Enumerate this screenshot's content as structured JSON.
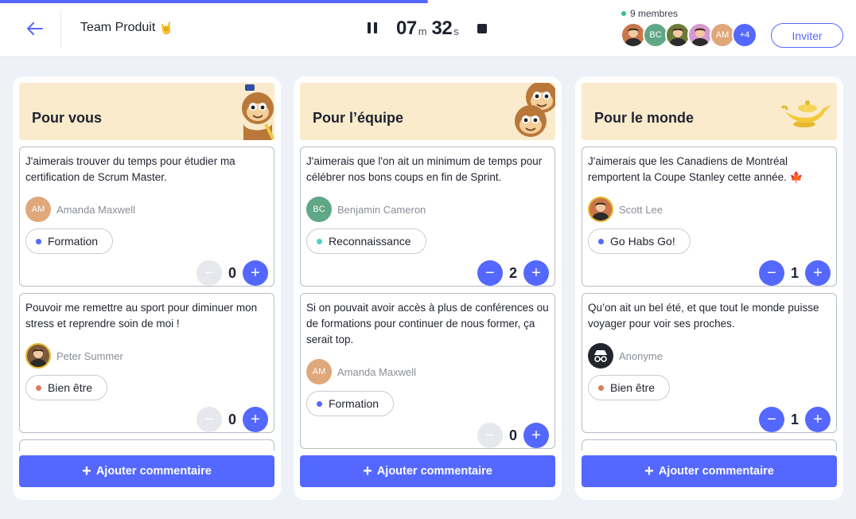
{
  "header": {
    "title": "Team Produit",
    "title_emoji": "🤘",
    "timer": {
      "minutes": "07",
      "minutes_unit": "m",
      "seconds": "32",
      "seconds_unit": "s"
    },
    "progress_fraction": 0.5,
    "members_label": "9 membres",
    "avatars": [
      {
        "initials": "",
        "color": "#c9764a",
        "icon": "avatar-photo-woman"
      },
      {
        "initials": "BC",
        "color": "#5fa787"
      },
      {
        "initials": "",
        "color": "#6a7a3a",
        "icon": "avatar-photo-man"
      },
      {
        "initials": "",
        "color": "#d79ad0",
        "icon": "avatar-photo-woman-2"
      },
      {
        "initials": "AM",
        "color": "#e0a77a"
      },
      {
        "initials": "+4",
        "color": "#5468ff"
      }
    ],
    "invite_label": "Inviter"
  },
  "columns": [
    {
      "title": "Pour vous",
      "illustration": "monkey-icon",
      "cards": [
        {
          "text": "J'aimerais trouver du temps pour étudier ma certification de Scrum Master.",
          "author": "Amanda Maxwell",
          "author_initials": "AM",
          "author_color": "#e0a77a",
          "tag": "Formation",
          "tag_color": "#5468ff",
          "votes": "0"
        },
        {
          "text": "Pouvoir me remettre au sport pour diminuer mon stress et reprendre soin de moi !",
          "author": "Peter Summer",
          "author_initials": "",
          "author_color": "#7c5a3b",
          "tag": "Bien être",
          "tag_color": "#e07a5a",
          "votes": "0"
        }
      ],
      "add_label": "Ajouter commentaire"
    },
    {
      "title": "Pour l’équipe",
      "illustration": "monkeys-icon",
      "cards": [
        {
          "text": "J'aimerais que l'on ait un minimum de temps pour célébrer nos bons coups en fin de Sprint.",
          "author": "Benjamin Cameron",
          "author_initials": "BC",
          "author_color": "#5fa787",
          "tag": "Reconnaissance",
          "tag_color": "#4fd1c5",
          "votes": "2"
        },
        {
          "text": "Si on pouvait avoir accès à plus de conférences ou de formations pour continuer de nous former, ça serait top.",
          "author": "Amanda Maxwell",
          "author_initials": "AM",
          "author_color": "#e0a77a",
          "tag": "Formation",
          "tag_color": "#5468ff",
          "votes": "0"
        }
      ],
      "add_label": "Ajouter commentaire"
    },
    {
      "title": "Pour le monde",
      "illustration": "magic-lamp-icon",
      "cards": [
        {
          "text": "J'aimerais que les Canadiens de Montréal remportent la Coupe Stanley cette année. 🍁",
          "author": "Scott Lee",
          "author_initials": "",
          "author_color": "#c9764a",
          "tag": "Go Habs Go!",
          "tag_color": "#5468ff",
          "votes": "1"
        },
        {
          "text": "Qu’on ait un bel été, et que tout le monde puisse voyager pour voir ses proches.",
          "author": "Anonyme",
          "author_initials": "",
          "author_color": "#23252e",
          "tag": "Bien être",
          "tag_color": "#e07a5a",
          "votes": "1"
        }
      ],
      "add_label": "Ajouter commentaire"
    }
  ],
  "colors": {
    "accent": "#5468ff",
    "header_bg": "#f9ebcb",
    "page_bg": "#eef1f8"
  }
}
